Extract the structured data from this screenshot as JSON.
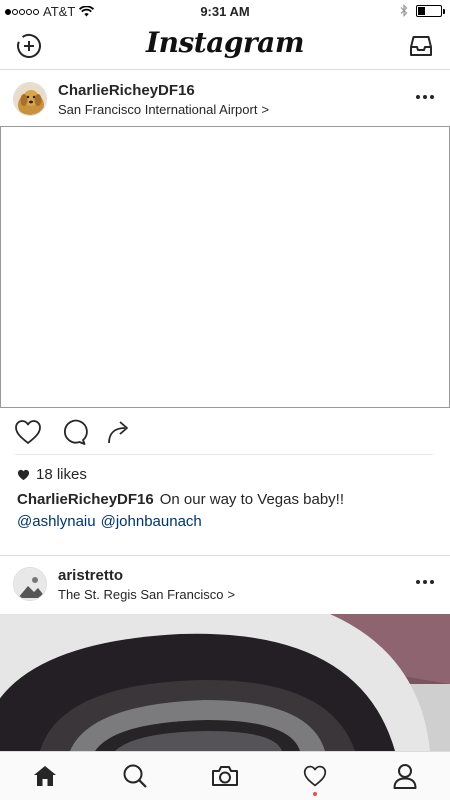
{
  "status_bar": {
    "carrier": "AT&T",
    "time": "9:31 AM"
  },
  "app": {
    "logo": "Instagram"
  },
  "posts": [
    {
      "username": "CharlieRicheyDF16",
      "location": "San Francisco International Airport",
      "location_chevron": ">",
      "likes": "18 likes",
      "caption_text": "On our way to Vegas baby!!",
      "mentions": [
        "@ashlynaiu",
        "@johnbaunach"
      ]
    },
    {
      "username": "aristretto",
      "location": "The St. Regis San Francisco",
      "location_chevron": ">"
    }
  ],
  "colors": {
    "accent_dot": "#ed4956",
    "mention": "#003569",
    "border": "#dbdbdb"
  },
  "icons": {
    "top_left": "add-story-icon",
    "top_right": "inbox-icon",
    "actions": [
      "heart-icon",
      "comment-icon",
      "share-icon"
    ],
    "bottom_nav": [
      "home-icon",
      "search-icon",
      "camera-icon",
      "heart-icon",
      "profile-icon"
    ]
  }
}
